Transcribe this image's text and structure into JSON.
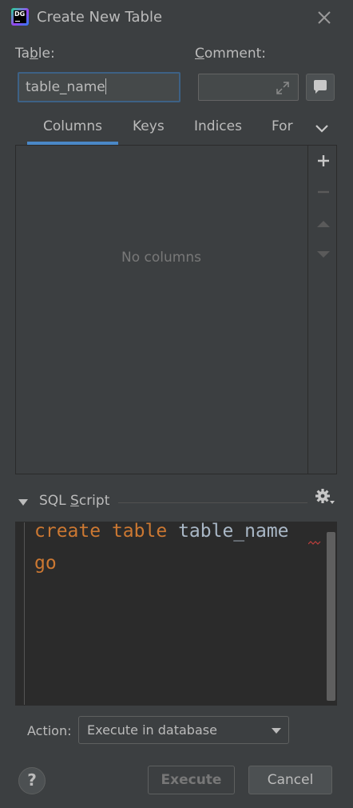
{
  "window": {
    "title": "Create New Table",
    "app_icon_text": "DG"
  },
  "form": {
    "table_label_prefix": "Ta",
    "table_label_mnemonic": "b",
    "table_label_suffix": "le:",
    "table_value": "table_name",
    "comment_label_mnemonic": "C",
    "comment_label_suffix": "omment:",
    "comment_value": ""
  },
  "tabs": [
    {
      "label": "Columns",
      "selected": true
    },
    {
      "label": "Keys",
      "selected": false
    },
    {
      "label": "Indices",
      "selected": false
    },
    {
      "label": "For",
      "selected": false
    }
  ],
  "columns_panel": {
    "empty_text": "No columns"
  },
  "sql_section": {
    "label_prefix": "SQL ",
    "label_mnemonic": "S",
    "label_suffix": "cript",
    "code_line1_kw1": "create",
    "code_line1_kw2": "table",
    "code_line1_ident": "table_name",
    "code_line2_kw": "go"
  },
  "action": {
    "label": "Action:",
    "selected": "Execute in database"
  },
  "buttons": {
    "execute": "Execute",
    "cancel": "Cancel",
    "help": "?"
  },
  "colors": {
    "background": "#3c3f41",
    "editor_bg": "#2b2b2b",
    "keyword": "#cc7832",
    "identifier": "#a9b7c6",
    "selected_tab": "#4a88c7"
  },
  "icons": {
    "close": "close-icon",
    "expand": "expand-icon",
    "comment": "speech-bubble-icon",
    "more_tabs": "chevron-down-icon",
    "add": "plus-icon",
    "remove": "minus-icon",
    "move_up": "triangle-up-icon",
    "move_down": "triangle-down-icon",
    "collapse": "triangle-down-icon",
    "settings": "gear-icon",
    "dropdown": "triangle-down-icon"
  }
}
